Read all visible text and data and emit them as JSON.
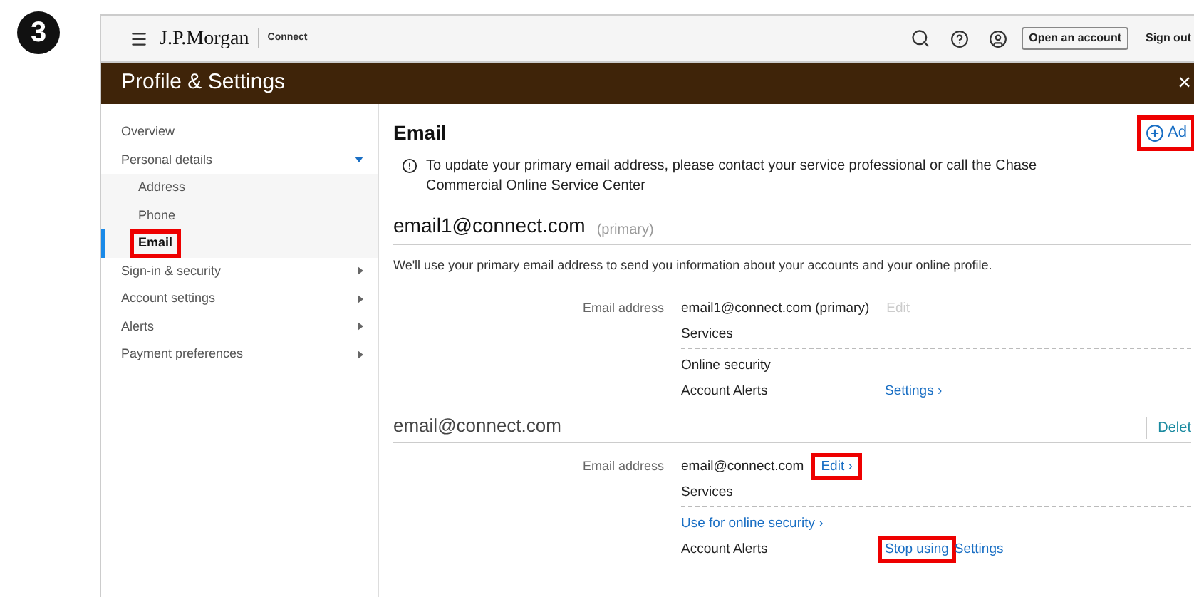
{
  "step_badge": "3",
  "header": {
    "logo": "J.P.Morgan",
    "product": "Connect",
    "open_account": "Open an account",
    "sign_out": "Sign out"
  },
  "title_bar": {
    "title": "Profile & Settings",
    "close": "×"
  },
  "sidebar": {
    "items": [
      {
        "label": "Overview",
        "selected": false
      },
      {
        "label": "Personal details",
        "selected": false,
        "expanded": true,
        "children": [
          {
            "label": "Address",
            "selected": false,
            "highlighted": false
          },
          {
            "label": "Phone",
            "selected": false,
            "highlighted": false
          },
          {
            "label": "Email",
            "selected": true,
            "highlighted": true
          }
        ]
      },
      {
        "label": "Sign-in & security",
        "selected": false,
        "expanded": false
      },
      {
        "label": "Account settings",
        "selected": false,
        "expanded": false
      },
      {
        "label": "Alerts",
        "selected": false,
        "expanded": false
      },
      {
        "label": "Payment preferences",
        "selected": false,
        "expanded": false
      }
    ]
  },
  "main": {
    "heading": "Email",
    "add_button": {
      "label": "Ad",
      "highlighted": true
    },
    "notice": "To update your primary email address, please contact your service professional or call the Chase Commercial Online Service Center",
    "emails": [
      {
        "address": "email1@connect.com",
        "tag": "(primary)",
        "description": "We'll use your primary email address to send you information about your accounts and your online profile.",
        "field_label": "Email address",
        "value": "email1@connect.com (primary)",
        "edit": {
          "label": "Edit",
          "disabled": true,
          "highlighted": false
        },
        "services_label": "Services",
        "services": [
          {
            "name": "Online security",
            "kind": "text"
          },
          {
            "name": "Account Alerts",
            "kind": "text",
            "actions": [
              {
                "label": "Settings ›",
                "highlighted": false
              }
            ]
          }
        ]
      },
      {
        "address": "email@connect.com",
        "delete": "Delet",
        "field_label": "Email address",
        "value": "email@connect.com",
        "edit": {
          "label": "Edit ›",
          "disabled": false,
          "highlighted": true
        },
        "services_label": "Services",
        "services": [
          {
            "name": "Use for online security ›",
            "kind": "link"
          },
          {
            "name": "Account Alerts",
            "kind": "text",
            "actions": [
              {
                "label": "Stop using",
                "highlighted": true
              },
              {
                "label": "Settings",
                "highlighted": false
              }
            ]
          }
        ]
      }
    ]
  }
}
